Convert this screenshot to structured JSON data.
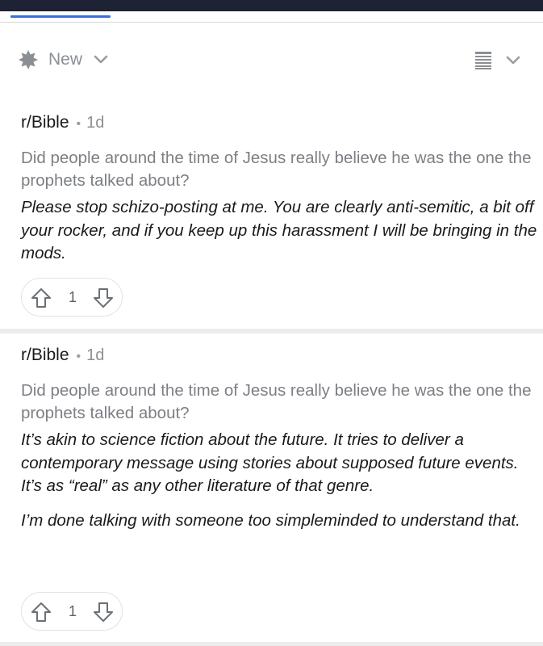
{
  "sort": {
    "label": "New",
    "icon": "spark-icon"
  },
  "posts": [
    {
      "subreddit": "r/Bible",
      "separator": "•",
      "age": "1d",
      "title": "Did people around the time of Jesus really believe he was the one the prophets talked about?",
      "body": [
        "Please stop schizo-posting at me. You are clearly anti-semitic, a bit off your rocker, and if you keep up this harassment I will be bringing in the mods."
      ],
      "score": "1"
    },
    {
      "subreddit": "r/Bible",
      "separator": "•",
      "age": "1d",
      "title": "Did people around the time of Jesus really believe he was the one the prophets talked about?",
      "body": [
        "It’s akin to science fiction about the future. It tries to deliver a contemporary message using stories about supposed future events. It’s as “real” as any other literature of that genre.",
        "I’m done talking with someone too simpleminded to understand that."
      ],
      "score": "1"
    }
  ],
  "colors": {
    "topbar": "#1d2334",
    "tab_indicator": "#3c6fd6",
    "muted_text": "#7c7f84",
    "separator": "#ececed"
  }
}
